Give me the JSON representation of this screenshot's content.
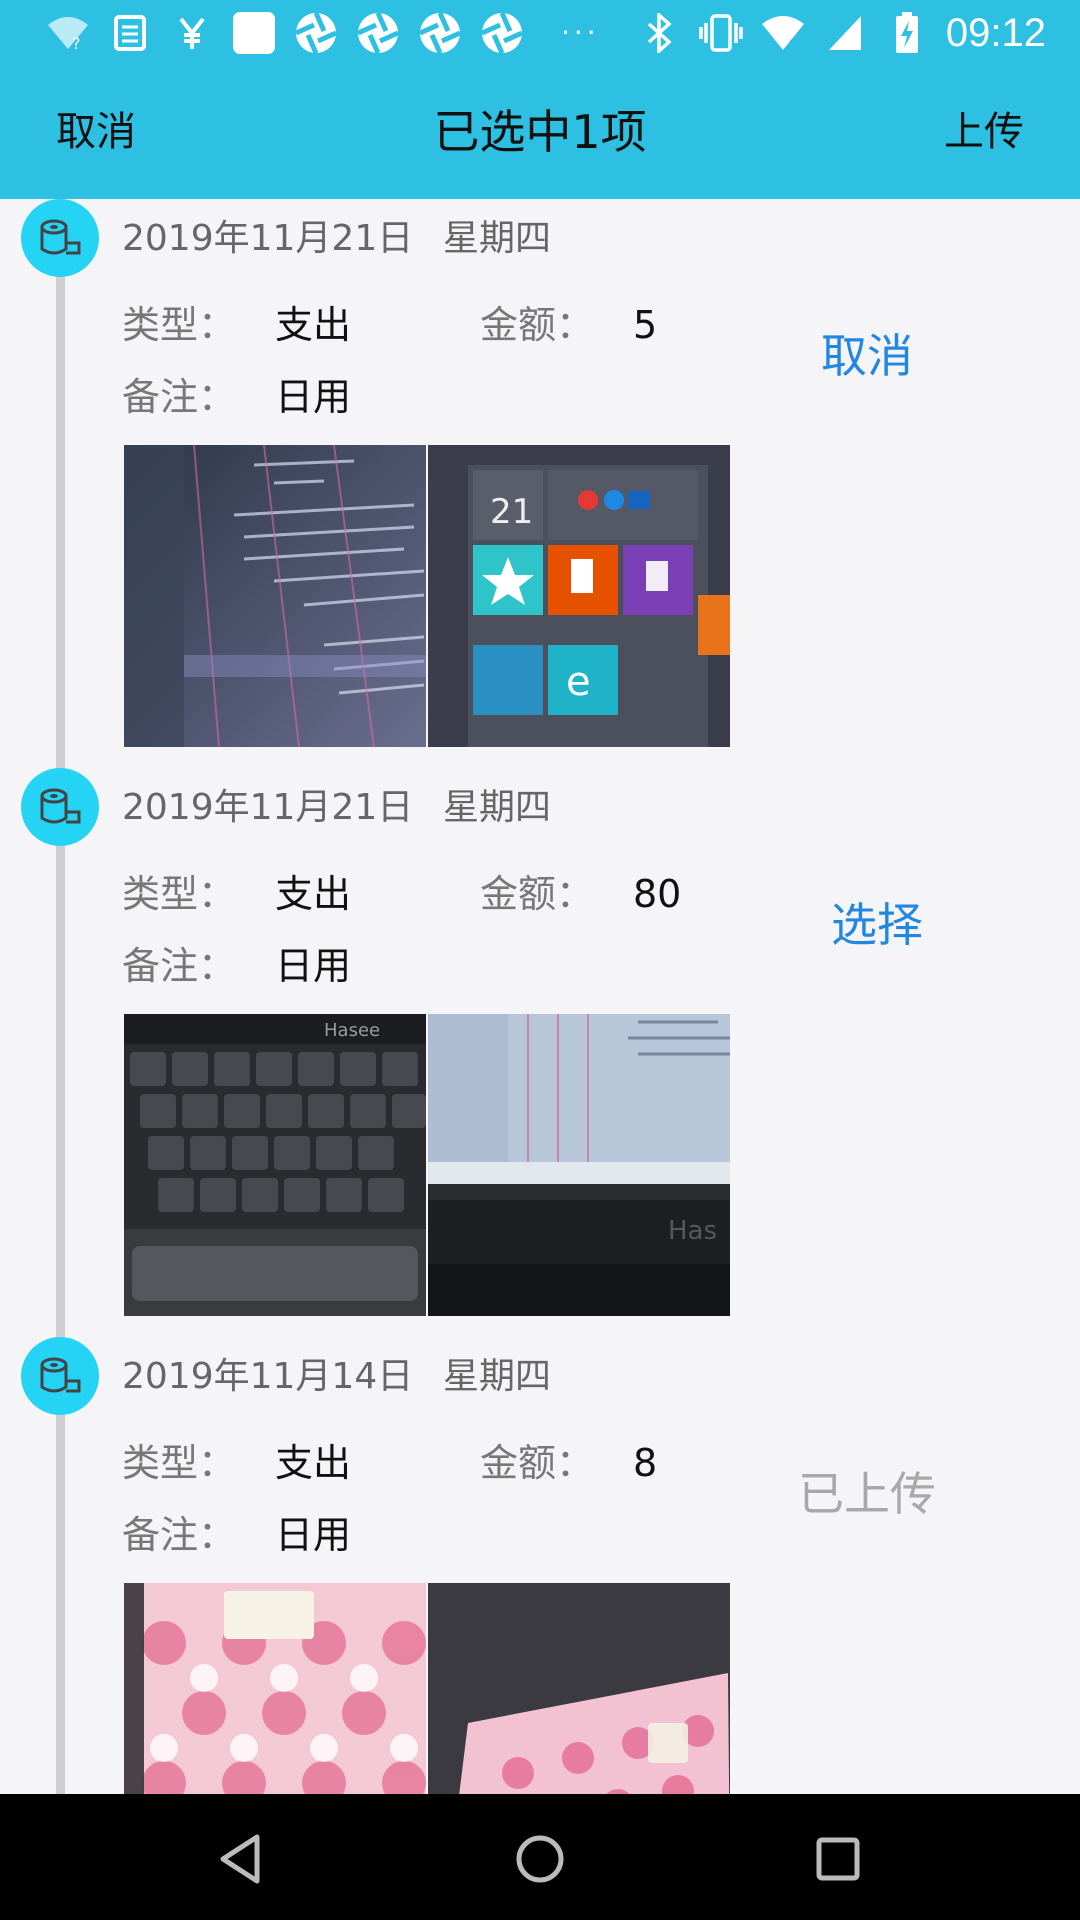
{
  "status_bar": {
    "time": "09:12",
    "left_icons": [
      "wifi-question-icon",
      "clipboard-list-icon",
      "yen-icon",
      "blank-square-icon",
      "aperture-icon",
      "aperture-icon",
      "aperture-icon",
      "aperture-icon"
    ],
    "overflow": "···",
    "right_icons": [
      "bluetooth-icon",
      "vibrate-icon",
      "wifi-icon",
      "signal-icon",
      "battery-charging-icon"
    ]
  },
  "app_bar": {
    "cancel_label": "取消",
    "title": "已选中1项",
    "upload_label": "上传",
    "background": "#2ec0e2"
  },
  "labels": {
    "type": "类型：",
    "amount": "金额：",
    "note": "备注："
  },
  "records": [
    {
      "date": "2019年11月21日",
      "weekday": "星期四",
      "type": "支出",
      "amount": "5",
      "note": "日用",
      "action": "取消",
      "action_state": "selected",
      "photos": [
        "code-editor-photo",
        "windows-start-menu-photo"
      ]
    },
    {
      "date": "2019年11月21日",
      "weekday": "星期四",
      "type": "支出",
      "amount": "80",
      "note": "日用",
      "action": "选择",
      "action_state": "selectable",
      "photos": [
        "keyboard-photo",
        "laptop-screen-photo"
      ]
    },
    {
      "date": "2019年11月14日",
      "weekday": "星期四",
      "type": "支出",
      "amount": "8",
      "note": "日用",
      "action": "已上传",
      "action_state": "uploaded",
      "photos": [
        "tissue-pack-photo",
        "tissue-pack-angled-photo"
      ]
    }
  ],
  "colors": {
    "accent_blue": "#2187e0",
    "badge": "#25d3f5",
    "disabled_gray": "#a8a8a8"
  },
  "nav_bar": {
    "buttons": [
      "back-icon",
      "home-icon",
      "recents-icon"
    ]
  }
}
